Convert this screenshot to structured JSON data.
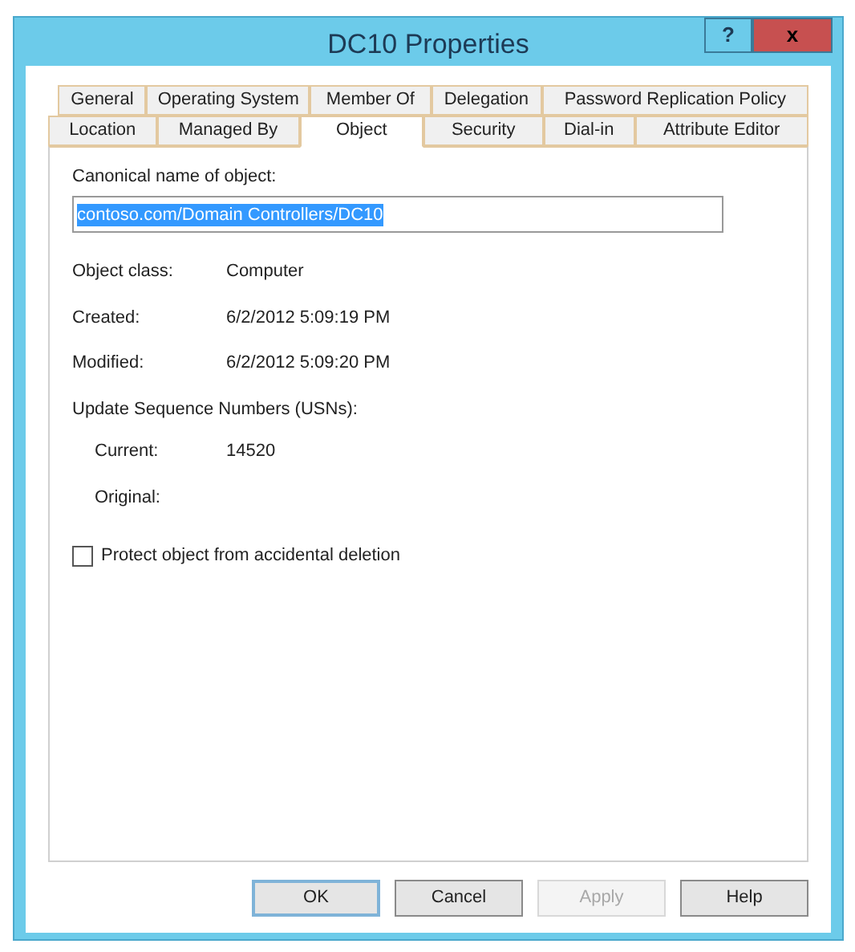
{
  "window": {
    "title": "DC10 Properties",
    "controls": [
      "?",
      "x"
    ]
  },
  "tab_rows": [
    [
      {
        "label": "General",
        "selected": false
      },
      {
        "label": "Operating System",
        "selected": false
      },
      {
        "label": "Member Of",
        "selected": false
      },
      {
        "label": "Delegation",
        "selected": false
      },
      {
        "label": "Password Replication Policy",
        "selected": false
      }
    ],
    [
      {
        "label": "Location",
        "selected": false
      },
      {
        "label": "Managed By",
        "selected": false
      },
      {
        "label": "Object",
        "selected": true
      },
      {
        "label": "Security",
        "selected": false
      },
      {
        "label": "Dial-in",
        "selected": false
      },
      {
        "label": "Attribute Editor",
        "selected": false
      }
    ]
  ],
  "canonical_name": {
    "label": "Canonical name of object:",
    "value": "contoso.com/Domain Controllers/DC10"
  },
  "properties": [
    {
      "label": "Object class:",
      "value": "Computer"
    },
    {
      "label": "Created:",
      "value": "6/2/2012 5:09:19 PM"
    },
    {
      "label": "Modified:",
      "value": "6/2/2012 5:09:20 PM"
    }
  ],
  "usn": {
    "heading": "Update Sequence Numbers (USNs):",
    "rows": [
      {
        "label": "Current:",
        "value": "14520"
      },
      {
        "label": "Original:"
      }
    ]
  },
  "protect_checkbox": {
    "label": "Protect object from accidental deletion",
    "checked": false
  },
  "buttons": [
    {
      "label": "OK",
      "disabled": false
    },
    {
      "label": "Cancel",
      "disabled": false
    },
    {
      "label": "Apply",
      "disabled": true
    },
    {
      "label": "Help",
      "disabled": false
    }
  ]
}
